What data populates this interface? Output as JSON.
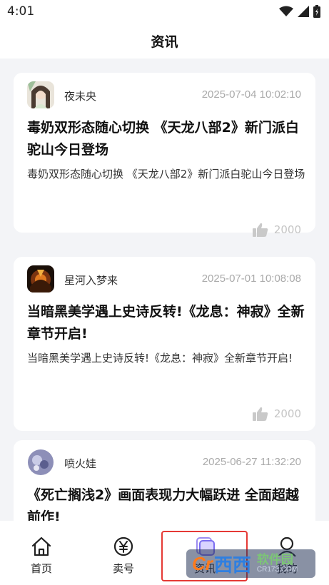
{
  "status": {
    "time": "4:01"
  },
  "header": {
    "title": "资讯"
  },
  "articles": [
    {
      "author": "夜未央",
      "time": "2025-07-04 10:02:10",
      "title": "毒奶双形态随心切换 《天龙八部2》新门派白驼山今日登场",
      "summary": "毒奶双形态随心切换 《天龙八部2》新门派白驼山今日登场",
      "likes": "2000"
    },
    {
      "author": "星河入梦来",
      "time": "2025-07-01 10:08:08",
      "title": "当暗黑美学遇上史诗反转!《龙息：神寂》全新章节开启!",
      "summary": "当暗黑美学遇上史诗反转!《龙息：神寂》全新章节开启!",
      "likes": "2000"
    },
    {
      "author": "喷火娃",
      "time": "2025-06-27 11:32:20",
      "title": "《死亡搁浅2》画面表现力大幅跃进 全面超越前作!",
      "summary": "",
      "likes": ""
    }
  ],
  "tabs": [
    {
      "label": "首页",
      "icon": "home-icon"
    },
    {
      "label": "卖号",
      "icon": "yen-icon"
    },
    {
      "label": "资讯",
      "icon": "news-icon"
    },
    {
      "label": "我的",
      "icon": "user-icon"
    }
  ],
  "watermark": {
    "logo": "Cr",
    "brand": "西西",
    "cn": "软件园",
    "en": "CR173.COM"
  }
}
